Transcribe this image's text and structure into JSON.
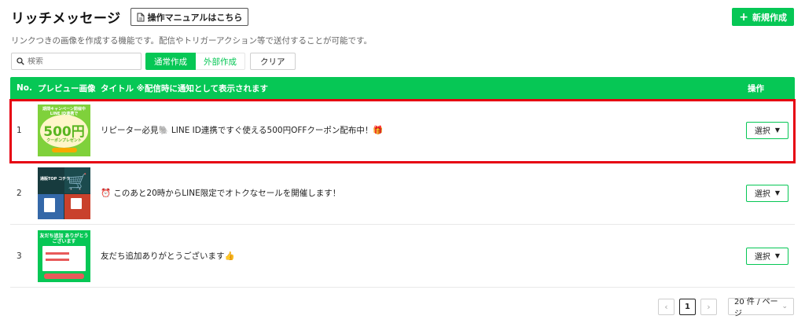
{
  "header": {
    "title": "リッチメッセージ",
    "manual_button": "操作マニュアルはこちら",
    "new_button": "新規作成"
  },
  "description": "リンクつきの画像を作成する機能です。配信やトリガーアクション等で送付することが可能です。",
  "filters": {
    "search_placeholder": "検索",
    "tab_normal": "通常作成",
    "tab_external": "外部作成",
    "clear": "クリア"
  },
  "table": {
    "columns": {
      "no": "No.",
      "preview": "プレビュー画像",
      "title": "タイトル ※配信時に通知として表示されます",
      "operation": "操作"
    },
    "rows": [
      {
        "no": "1",
        "title": "リピーター必見🐘 LINE ID連携ですぐ使える500円OFFクーポン配布中！🎁",
        "action": "選択",
        "thumb": {
          "top": "期間キャンペーン開催中 LINE ID連携で",
          "big": "500円",
          "sub": "クーポンプレゼント"
        }
      },
      {
        "no": "2",
        "title": "⏰ このあと20時からLINE限定でオトクなセールを開催します！",
        "action": "選択",
        "thumb": {
          "top": "通販TOP コチラ"
        }
      },
      {
        "no": "3",
        "title": "友だち追加ありがとうございます👍",
        "action": "選択",
        "thumb": {
          "top": "友だち追加 ありがとうございます"
        }
      }
    ]
  },
  "pagination": {
    "prev": "‹",
    "current": "1",
    "next": "›",
    "per_page": "20 件 / ページ"
  },
  "colors": {
    "brand_green": "#06c755",
    "highlight_red": "#e60012"
  }
}
